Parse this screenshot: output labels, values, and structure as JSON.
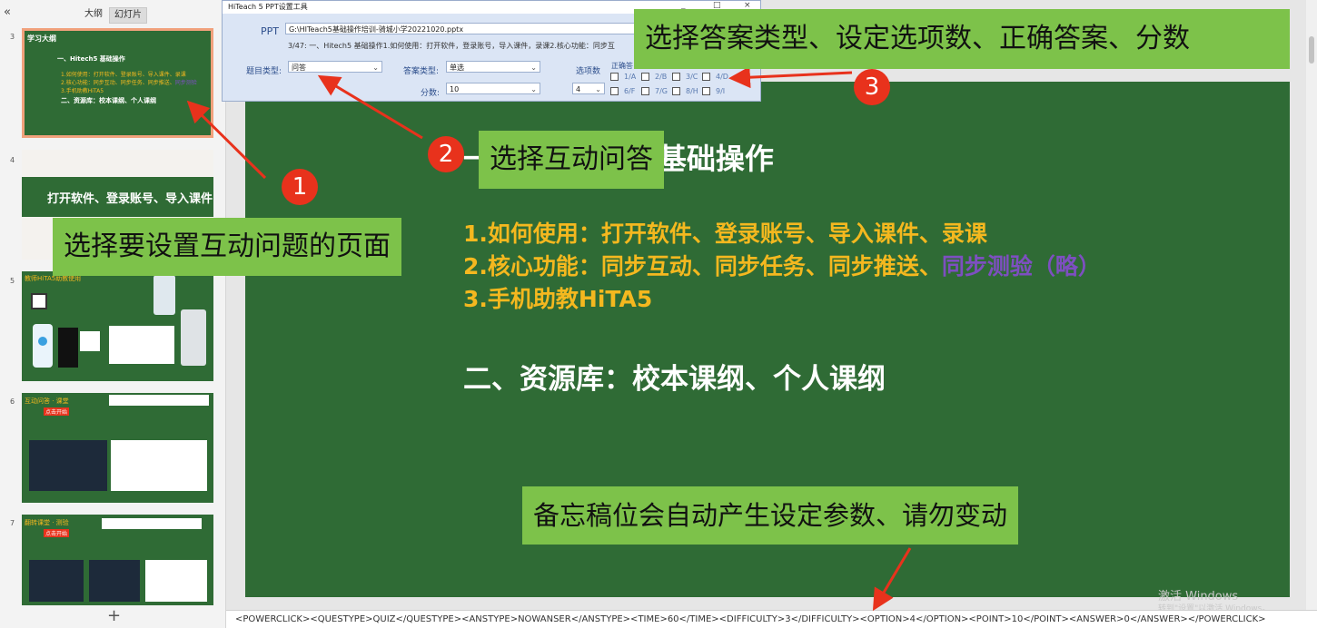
{
  "left_panel": {
    "collapse_glyph": "«",
    "tabs": [
      "大纲",
      "幻灯片"
    ],
    "slides": [
      {
        "number": "3",
        "title": "学习大纲",
        "subtitle": "一、Hitech5 基础操作",
        "lines": [
          "1.如何使用：打开软件、登录账号、导入课件、录课",
          "2.核心功能：同步互动、同步任务、同步推送、",
          "3.手机助教HiTA5"
        ],
        "line2_extra": "同步测验",
        "section": "二、资源库：校本课纲、个人课纲"
      },
      {
        "number": "4",
        "title": "打开软件、登录账号、导入课件"
      },
      {
        "number": "5",
        "title": "教师HiTA5助教使用"
      },
      {
        "number": "6",
        "title": "互动问答 · 课堂",
        "tag": "点击开始"
      },
      {
        "number": "7",
        "title": "翻转课堂 · 测验",
        "tag": "点击开始"
      }
    ],
    "add_label": "+"
  },
  "dialog": {
    "title": "HiTeach 5 PPT设置工具",
    "window_buttons": [
      "_",
      "□",
      "×"
    ],
    "ppt_label": "PPT",
    "ppt_path": "G:\\HITeach5基础操作培训-骑城小学20221020.pptx",
    "slide_info": "3/47: 一、Hitech5 基础操作1.如何使用：打开软件，登录账号，导入课件，录课2.核心功能：同步互",
    "question_type_label": "题目类型:",
    "question_type_value": "问答",
    "answer_type_label": "答案类型:",
    "answer_type_value": "单选",
    "score_label": "分数:",
    "score_value": "10",
    "option_count_label": "选项数",
    "option_count_value": "4",
    "correct_answer_label": "正确答",
    "options_row1": [
      "1/A",
      "2/B",
      "3/C",
      "4/D"
    ],
    "options_row2": [
      "6/F",
      "7/G",
      "8/H",
      "9/I"
    ]
  },
  "slide": {
    "title": "一、Hitech5 基础操作",
    "line1": "1.如何使用：打开软件、登录账号、导入课件、录课",
    "line2": "2.核心功能：同步互动、同步任务、同步推送、",
    "line2_purple": "同步测验（略）",
    "line3": "3.手机助教HiTA5",
    "section2": "二、资源库：校本课纲、个人课纲"
  },
  "callouts": {
    "c1": "选择要设置互动问题的页面",
    "c2": "选择互动问答",
    "c3": "选择答案类型、设定选项数、正确答案、分数",
    "c4": "备忘稿位会自动产生设定参数、请勿变动",
    "b1": "1",
    "b2": "2",
    "b3": "3"
  },
  "notes": {
    "text": "<POWERCLICK><QUESTYPE>QUIZ</QUESTYPE><ANSTYPE>NOWANSER</ANSTYPE><TIME>60</TIME><DIFFICULTY>3</DIFFICULTY><OPTION>4</OPTION><POINT>10</POINT><ANSWER>0</ANSWER></POWERCLICK>"
  },
  "watermark": {
    "line1": "激活 Windows",
    "line2": "转到\"设置\"以激活 Windows。"
  },
  "colors": {
    "slide_green": "#2f6b35",
    "callout_green": "#7dc24a",
    "badge_red": "#e8321c",
    "yellow_text": "#f4b81f",
    "purple_text": "#7d4fc0"
  }
}
